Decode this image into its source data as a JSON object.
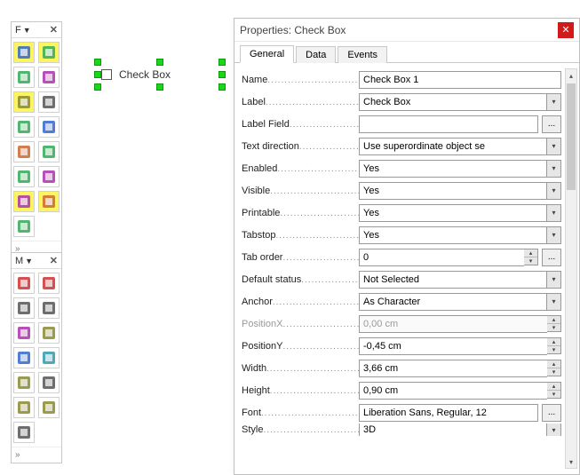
{
  "palette_forms": {
    "title": "F",
    "close": "✕"
  },
  "palette_more": {
    "title": "M",
    "close": "✕"
  },
  "canvas": {
    "checkbox_label": "Check Box"
  },
  "dialog": {
    "title": "Properties: Check Box",
    "close": "✕",
    "tabs": [
      "General",
      "Data",
      "Events"
    ],
    "active_tab": 0,
    "ellipsis": "...",
    "scroll": {
      "up": "▴",
      "down": "▾"
    },
    "fields": [
      {
        "key": "name",
        "label": "Name",
        "type": "text",
        "value": "Check Box 1"
      },
      {
        "key": "label",
        "label": "Label",
        "type": "combo",
        "value": "Check Box"
      },
      {
        "key": "label_field",
        "label": "Label Field",
        "type": "text",
        "value": "",
        "trail": "ellipsis"
      },
      {
        "key": "text_dir",
        "label": "Text direction",
        "type": "combo",
        "value": "Use superordinate object se"
      },
      {
        "key": "enabled",
        "label": "Enabled",
        "type": "combo",
        "value": "Yes"
      },
      {
        "key": "visible",
        "label": "Visible",
        "type": "combo",
        "value": "Yes"
      },
      {
        "key": "printable",
        "label": "Printable",
        "type": "combo",
        "value": "Yes"
      },
      {
        "key": "tabstop",
        "label": "Tabstop",
        "type": "combo",
        "value": "Yes"
      },
      {
        "key": "tab_order",
        "label": "Tab order",
        "type": "spin",
        "value": "0",
        "trail": "ellipsis"
      },
      {
        "key": "default_status",
        "label": "Default status",
        "type": "combo",
        "value": "Not Selected"
      },
      {
        "key": "anchor",
        "label": "Anchor",
        "type": "combo",
        "value": "As Character"
      },
      {
        "key": "positionx",
        "label": "PositionX",
        "type": "spin",
        "value": "0,00 cm",
        "disabled": true
      },
      {
        "key": "positiony",
        "label": "PositionY",
        "type": "spin",
        "value": "-0,45 cm"
      },
      {
        "key": "width",
        "label": "Width",
        "type": "spin",
        "value": "3,66 cm"
      },
      {
        "key": "height",
        "label": "Height",
        "type": "spin",
        "value": "0,90 cm"
      },
      {
        "key": "font",
        "label": "Font",
        "type": "text",
        "value": "Liberation Sans, Regular, 12",
        "trail": "ellipsis"
      },
      {
        "key": "style",
        "label": "Style",
        "type": "combo",
        "value": "3D",
        "cut": true
      }
    ]
  },
  "tool_icons": {
    "forms": [
      {
        "name": "select-tool-icon",
        "hl": true
      },
      {
        "name": "edit-tool-icon",
        "hl": true
      },
      {
        "name": "grid-tool-icon"
      },
      {
        "name": "box-tool-icon"
      },
      {
        "name": "checkbox-tool-icon",
        "hl": true
      },
      {
        "name": "textbox-tool-icon"
      },
      {
        "name": "hash-tool-icon"
      },
      {
        "name": "circle-tool-icon"
      },
      {
        "name": "radio-tool-icon"
      },
      {
        "name": "list-tool-icon"
      },
      {
        "name": "save-tool-icon"
      },
      {
        "name": "abc-tool-icon"
      },
      {
        "name": "low-tool-icon",
        "hl": true
      },
      {
        "name": "table-tool-icon",
        "hl": true
      },
      {
        "name": "wand-tool-icon"
      }
    ],
    "more": [
      {
        "name": "toggle1-icon"
      },
      {
        "name": "toggle2-icon"
      },
      {
        "name": "doc1-icon"
      },
      {
        "name": "doc2-icon"
      },
      {
        "name": "calendar-icon"
      },
      {
        "name": "clock-icon"
      },
      {
        "name": "pin-icon"
      },
      {
        "name": "num123-icon"
      },
      {
        "name": "coins-icon"
      },
      {
        "name": "box2-icon"
      },
      {
        "name": "grid2-icon"
      },
      {
        "name": "grid3-icon"
      },
      {
        "name": "dash-icon"
      }
    ]
  }
}
